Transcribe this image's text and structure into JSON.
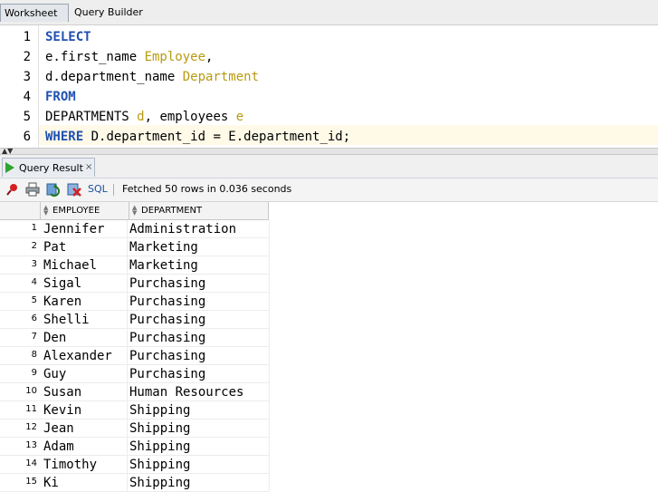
{
  "tabs": {
    "worksheet": "Worksheet",
    "query_builder": "Query Builder"
  },
  "editor": {
    "line_numbers": [
      "1",
      "2",
      "3",
      "4",
      "5",
      "6"
    ],
    "lines": [
      [
        {
          "t": "SELECT",
          "c": "kw"
        }
      ],
      [
        {
          "t": "e.first_name ",
          "c": "plain"
        },
        {
          "t": "Employee",
          "c": "alias"
        },
        {
          "t": ",",
          "c": "plain"
        }
      ],
      [
        {
          "t": "d.department_name ",
          "c": "plain"
        },
        {
          "t": "Department",
          "c": "alias"
        }
      ],
      [
        {
          "t": "FROM",
          "c": "kw"
        }
      ],
      [
        {
          "t": "DEPARTMENTS ",
          "c": "plain"
        },
        {
          "t": "d",
          "c": "alias"
        },
        {
          "t": ", employees ",
          "c": "plain"
        },
        {
          "t": "e",
          "c": "alias"
        }
      ],
      [
        {
          "t": "WHERE",
          "c": "kw"
        },
        {
          "t": " D.department_id = E.department_id;",
          "c": "plain"
        }
      ]
    ]
  },
  "result_tab": {
    "label": "Query Result",
    "close": "×"
  },
  "toolbar": {
    "sql_label": "SQL",
    "status": "Fetched 50 rows in 0.036 seconds"
  },
  "grid": {
    "columns": [
      "EMPLOYEE",
      "DEPARTMENT"
    ],
    "rows": [
      {
        "n": "1",
        "employee": "Jennifer",
        "department": "Administration"
      },
      {
        "n": "2",
        "employee": "Pat",
        "department": "Marketing"
      },
      {
        "n": "3",
        "employee": "Michael",
        "department": "Marketing"
      },
      {
        "n": "4",
        "employee": "Sigal",
        "department": "Purchasing"
      },
      {
        "n": "5",
        "employee": "Karen",
        "department": "Purchasing"
      },
      {
        "n": "6",
        "employee": "Shelli",
        "department": "Purchasing"
      },
      {
        "n": "7",
        "employee": "Den",
        "department": "Purchasing"
      },
      {
        "n": "8",
        "employee": "Alexander",
        "department": "Purchasing"
      },
      {
        "n": "9",
        "employee": "Guy",
        "department": "Purchasing"
      },
      {
        "n": "10",
        "employee": "Susan",
        "department": "Human Resources"
      },
      {
        "n": "11",
        "employee": "Kevin",
        "department": "Shipping"
      },
      {
        "n": "12",
        "employee": "Jean",
        "department": "Shipping"
      },
      {
        "n": "13",
        "employee": "Adam",
        "department": "Shipping"
      },
      {
        "n": "14",
        "employee": "Timothy",
        "department": "Shipping"
      },
      {
        "n": "15",
        "employee": "Ki",
        "department": "Shipping"
      }
    ]
  },
  "icons": [
    "pin-icon",
    "print-icon",
    "refresh-icon",
    "delete-icon",
    "run-icon",
    "sort-icon"
  ],
  "colors": {
    "keyword": "#2050b0",
    "alias": "#b89a10",
    "current_line": "#fffae8",
    "run_green": "#2fa42f"
  }
}
